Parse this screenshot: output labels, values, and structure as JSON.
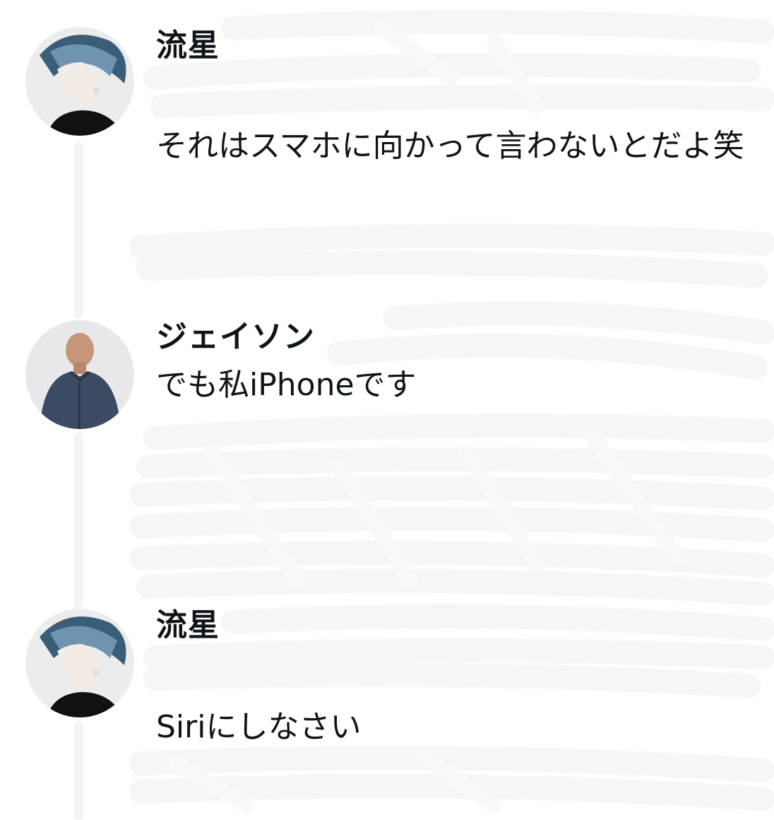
{
  "thread": {
    "top_fragment": "よ笑",
    "replies": [
      {
        "author": "流星",
        "text": "それはスマホに向かって言わないとだよ笑",
        "avatar": "anime-avatar"
      },
      {
        "author": "ジェイソン",
        "text": "でも私iPhoneです",
        "avatar": "man-photo-avatar"
      },
      {
        "author": "流星",
        "text": "Siriにしなさい",
        "avatar": "anime-avatar"
      }
    ]
  }
}
